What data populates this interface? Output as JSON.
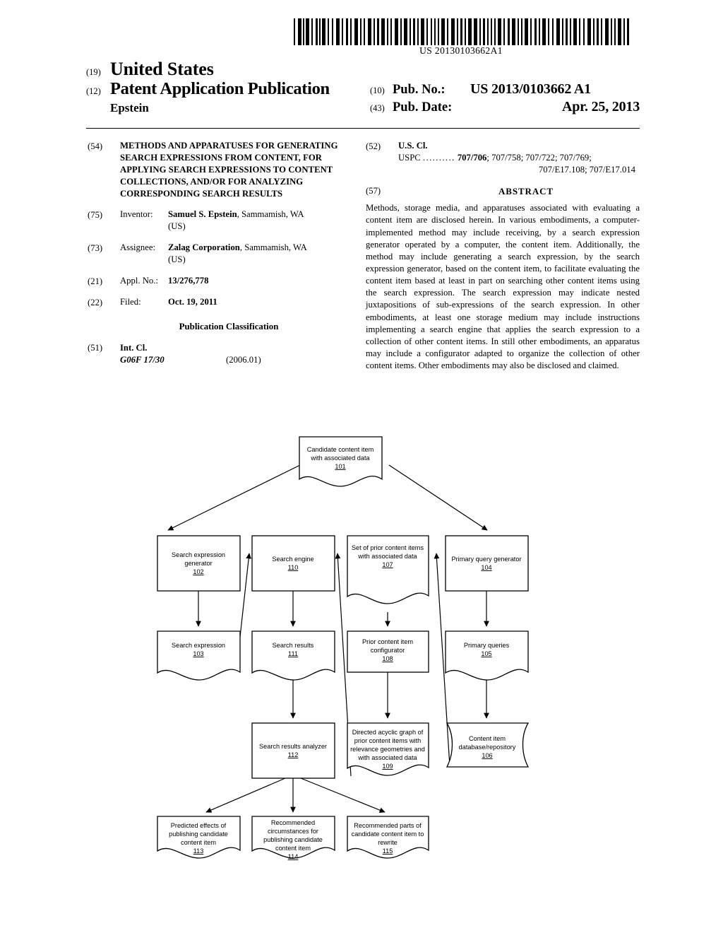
{
  "header": {
    "barcode_number": "US 20130103662A1",
    "code_19": "(19)",
    "country": "United States",
    "code_12": "(12)",
    "doc_type": "Patent Application Publication",
    "inventor_surname": "Epstein",
    "code_10": "(10)",
    "pub_no_label": "Pub. No.:",
    "pub_no_value": "US 2013/0103662 A1",
    "code_43": "(43)",
    "pub_date_label": "Pub. Date:",
    "pub_date_value": "Apr. 25, 2013"
  },
  "left_column": {
    "code_54": "(54)",
    "title": "METHODS AND APPARATUSES FOR GENERATING SEARCH EXPRESSIONS FROM CONTENT, FOR APPLYING SEARCH EXPRESSIONS TO CONTENT COLLECTIONS, AND/OR FOR ANALYZING CORRESPONDING SEARCH RESULTS",
    "code_75": "(75)",
    "inventor_label": "Inventor:",
    "inventor_name": "Samuel S. Epstein",
    "inventor_rest": ", Sammamish, WA",
    "inventor_country": "(US)",
    "code_73": "(73)",
    "assignee_label": "Assignee:",
    "assignee_name": "Zalag Corporation",
    "assignee_rest": ", Sammamish, WA",
    "assignee_country": "(US)",
    "code_21": "(21)",
    "appl_no_label": "Appl. No.:",
    "appl_no_value": "13/276,778",
    "code_22": "(22)",
    "filed_label": "Filed:",
    "filed_value": "Oct. 19, 2011",
    "pub_classification_heading": "Publication Classification",
    "code_51": "(51)",
    "int_cl_label": "Int. Cl.",
    "int_cl_code": "G06F 17/30",
    "int_cl_version": "(2006.01)"
  },
  "right_column": {
    "code_52": "(52)",
    "us_cl_label": "U.S. Cl.",
    "uspc_label": "USPC",
    "uspc_dots": "..........",
    "uspc_primary": "707/706",
    "uspc_rest": "; 707/758; 707/722; 707/769;",
    "uspc_second_line": "707/E17.108; 707/E17.014",
    "code_57": "(57)",
    "abstract_heading": "ABSTRACT",
    "abstract_text": "Methods, storage media, and apparatuses associated with evaluating a content item are disclosed herein. In various embodiments, a computer-implemented method may include receiving, by a search expression generator operated by a computer, the content item. Additionally, the method may include generating a search expression, by the search expression generator, based on the content item, to facilitate evaluating the content item based at least in part on searching other content items using the search expression. The search expression may indicate nested juxtapositions of sub-expressions of the search expression. In other embodiments, at least one storage medium may include instructions implementing a search engine that applies the search expression to a collection of other content items. In still other embodiments, an apparatus may include a configurator adapted to organize the collection of other content items. Other embodiments may also be disclosed and claimed."
  },
  "figure": {
    "nodes": [
      {
        "id": "101",
        "shape": "document",
        "lines": [
          "Candidate content item",
          "with associated data"
        ],
        "number": "101"
      },
      {
        "id": "102",
        "shape": "rect",
        "lines": [
          "Search expression",
          "generator"
        ],
        "number": "102"
      },
      {
        "id": "110",
        "shape": "rect",
        "lines": [
          "Search engine"
        ],
        "number": "110"
      },
      {
        "id": "107",
        "shape": "document",
        "lines": [
          "Set of prior content items",
          "with associated data"
        ],
        "number": "107"
      },
      {
        "id": "104",
        "shape": "rect",
        "lines": [
          "Primary query generator"
        ],
        "number": "104"
      },
      {
        "id": "103",
        "shape": "document",
        "lines": [
          "Search expression"
        ],
        "number": "103"
      },
      {
        "id": "111",
        "shape": "document",
        "lines": [
          "Search results"
        ],
        "number": "111"
      },
      {
        "id": "108",
        "shape": "rect",
        "lines": [
          "Prior content item",
          "configurator"
        ],
        "number": "108"
      },
      {
        "id": "105",
        "shape": "document",
        "lines": [
          "Primary queries"
        ],
        "number": "105"
      },
      {
        "id": "112",
        "shape": "rect",
        "lines": [
          "Search results analyzer"
        ],
        "number": "112"
      },
      {
        "id": "109",
        "shape": "document",
        "lines": [
          "Directed acyclic graph of",
          "prior content items with",
          "relevance geometries and",
          "with associated data"
        ],
        "number": "109"
      },
      {
        "id": "106",
        "shape": "database",
        "lines": [
          "Content item",
          "database/repository"
        ],
        "number": "106"
      },
      {
        "id": "113",
        "shape": "document",
        "lines": [
          "Predicted effects of",
          "publishing candidate",
          "content item"
        ],
        "number": "113"
      },
      {
        "id": "114",
        "shape": "document",
        "lines": [
          "Recommended",
          "circumstances for",
          "publishing candidate",
          "content item"
        ],
        "number": "114"
      },
      {
        "id": "115",
        "shape": "document",
        "lines": [
          "Recommended parts of",
          "candidate content item to",
          "rewrite"
        ],
        "number": "115"
      }
    ],
    "edges": [
      {
        "from": "101",
        "to": "102"
      },
      {
        "from": "101",
        "to": "104"
      },
      {
        "from": "102",
        "to": "103"
      },
      {
        "from": "103",
        "to": "110"
      },
      {
        "from": "110",
        "to": "111"
      },
      {
        "from": "111",
        "to": "112"
      },
      {
        "from": "112",
        "to": "113"
      },
      {
        "from": "112",
        "to": "114"
      },
      {
        "from": "112",
        "to": "115"
      },
      {
        "from": "107",
        "to": "108"
      },
      {
        "from": "108",
        "to": "109"
      },
      {
        "from": "109",
        "to": "110"
      },
      {
        "from": "104",
        "to": "105"
      },
      {
        "from": "105",
        "to": "106"
      },
      {
        "from": "106",
        "to": "107"
      }
    ]
  }
}
